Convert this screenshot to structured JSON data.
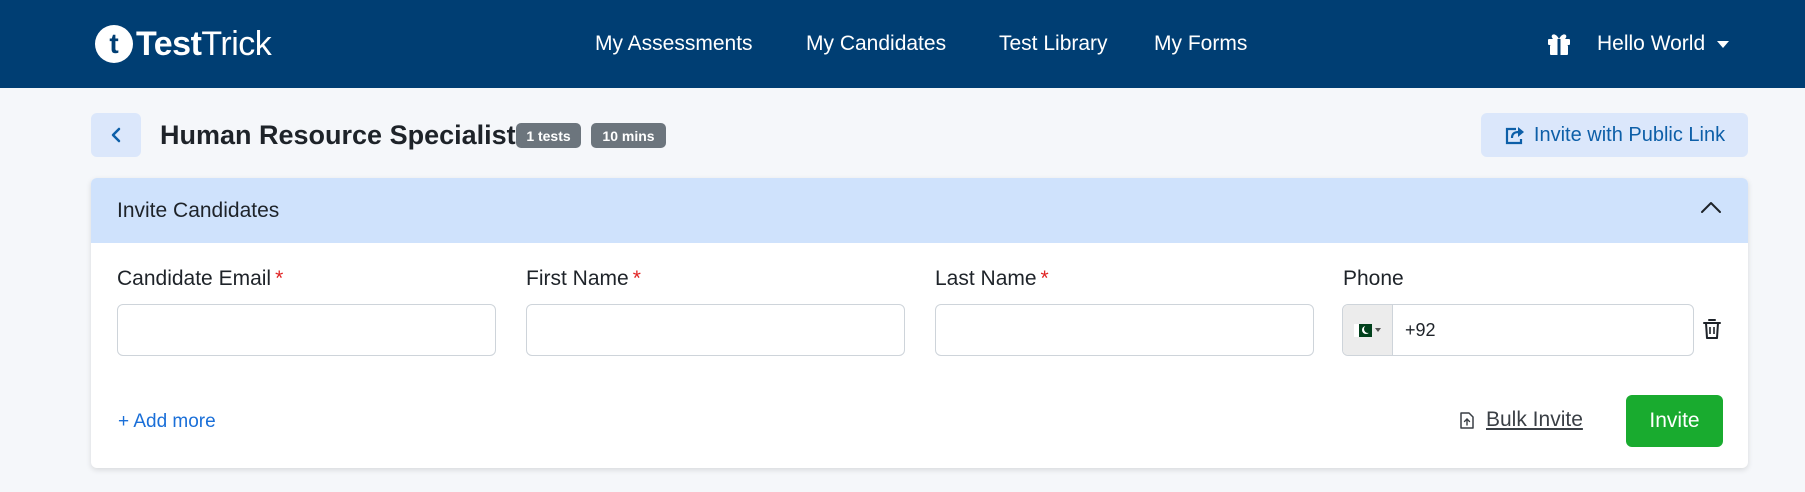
{
  "brand": {
    "logo_letter": "t",
    "name_bold": "Test",
    "name_light": "Trick"
  },
  "nav": {
    "links": [
      {
        "label": "My Assessments"
      },
      {
        "label": "My Candidates"
      },
      {
        "label": "Test Library"
      },
      {
        "label": "My Forms"
      }
    ],
    "user_label": "Hello World",
    "gift_icon": "gift-icon"
  },
  "page": {
    "title": "Human Resource Specialist",
    "badges": [
      "1 tests",
      "10 mins"
    ],
    "public_link_label": "Invite with Public Link"
  },
  "invite_card": {
    "header": "Invite Candidates",
    "fields": [
      {
        "label": "Candidate Email",
        "required_mark": "*",
        "value": ""
      },
      {
        "label": "First Name",
        "required_mark": "*",
        "value": ""
      },
      {
        "label": "Last Name",
        "required_mark": "*",
        "value": ""
      }
    ],
    "phone": {
      "label": "Phone",
      "country_flag": "pakistan-flag",
      "value": "+92"
    },
    "add_more_label": "+ Add more",
    "bulk_invite_label": "Bulk Invite",
    "invite_label": "Invite"
  },
  "colors": {
    "navbar": "#003e73",
    "accent_light": "#dbe7fb",
    "card_header": "#cfe2fc",
    "invite_green": "#19ab2f",
    "required_red": "#e02424"
  }
}
